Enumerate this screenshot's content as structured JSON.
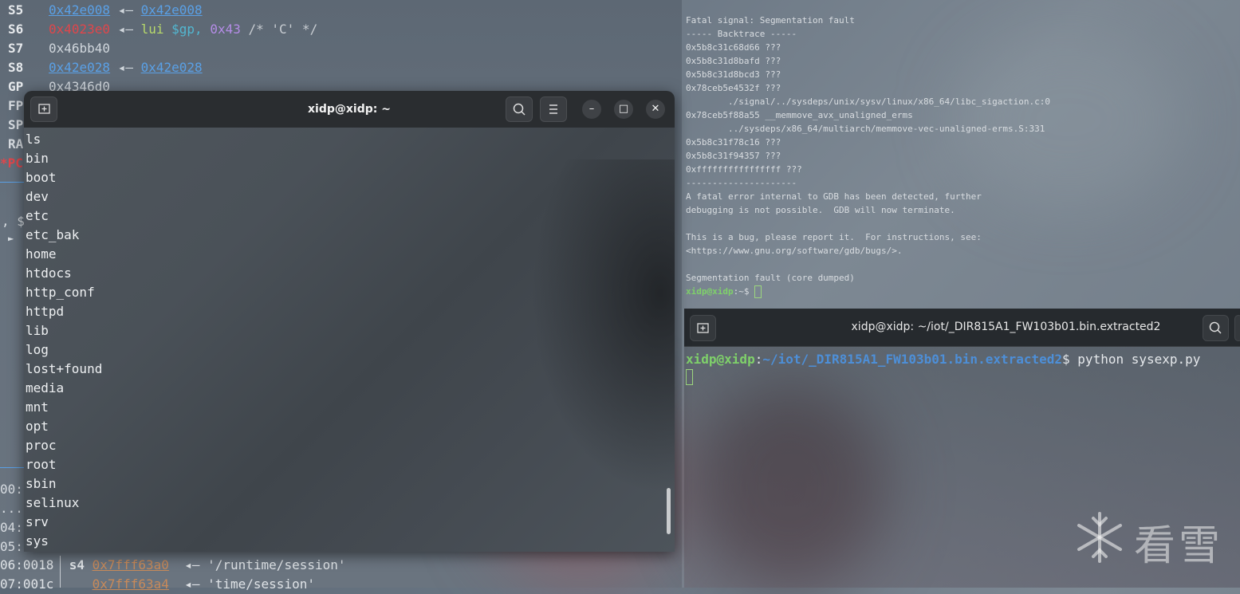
{
  "background_left": {
    "registers": [
      {
        "name": "S5",
        "value": "0x42e008",
        "arrow": "◂—",
        "target": "0x42e008"
      },
      {
        "name": "S6",
        "value": "0x4023e0",
        "arrow": "◂—",
        "instr": "lui",
        "reg": "$gp,",
        "imm": "0x43",
        "comment": "/* 'C' */"
      },
      {
        "name": "S7",
        "value": "0x46bb40"
      },
      {
        "name": "S8",
        "value": "0x42e028",
        "arrow": "◂—",
        "target": "0x42e028"
      },
      {
        "name": "GP",
        "value": "0x4346d0"
      }
    ],
    "edge_fragments": [
      "FP",
      "SP",
      "RA",
      "*PC",
      ", $",
      "►",
      "00:",
      "...",
      "04:",
      "05:"
    ],
    "stack": [
      {
        "prefix": "06:0018",
        "reg": "s4",
        "addr": "0x7fff63a0",
        "arrow": "◂—",
        "str": "'/runtime/session'"
      },
      {
        "prefix": "07:001c",
        "reg": "",
        "addr": "0x7fff63a4",
        "arrow": "◂—",
        "str": "'time/session'"
      }
    ]
  },
  "right_top_terminal": {
    "lines": [
      "Fatal signal: Segmentation fault",
      "----- Backtrace -----",
      "0x5b8c31c68d66 ???",
      "0x5b8c31d8bafd ???",
      "0x5b8c31d8bcd3 ???",
      "0x78ceb5e4532f ???",
      "        ./signal/../sysdeps/unix/sysv/linux/x86_64/libc_sigaction.c:0",
      "0x78ceb5f88a55 __memmove_avx_unaligned_erms",
      "        ../sysdeps/x86_64/multiarch/memmove-vec-unaligned-erms.S:331",
      "0x5b8c31f78c16 ???",
      "0x5b8c31f94357 ???",
      "0xffffffffffffffff ???",
      "---------------------",
      "A fatal error internal to GDB has been detected, further",
      "debugging is not possible.  GDB will now terminate.",
      "",
      "This is a bug, please report it.  For instructions, see:",
      "<https://www.gnu.org/software/gdb/bugs/>.",
      "",
      "Segmentation fault (core dumped)"
    ],
    "prompt_user": "xidp@xidp",
    "prompt_rest": ":~$ "
  },
  "right_bottom_terminal": {
    "title": "xidp@xidp: ~/iot/_DIR815A1_FW103b01.bin.extracted2",
    "prompt_user": "xidp@xidp",
    "prompt_sep": ":",
    "prompt_path": "~/iot/_DIR815A1_FW103b01.bin.extracted2",
    "prompt_dollar": "$ ",
    "command": "python sysexp.py"
  },
  "main_terminal": {
    "title": "xidp@xidp: ~",
    "lines": [
      "ls",
      "bin",
      "boot",
      "dev",
      "etc",
      "etc_bak",
      "home",
      "htdocs",
      "http_conf",
      "httpd",
      "lib",
      "log",
      "lost+found",
      "media",
      "mnt",
      "opt",
      "proc",
      "root",
      "sbin",
      "selinux",
      "srv",
      "sys"
    ],
    "buttons": {
      "minimize": "–",
      "maximize": "□",
      "close": "✕"
    }
  },
  "watermark": {
    "text": "看雪"
  },
  "colors": {
    "accent_green": "#7fd16a",
    "path_blue": "#4d8fd8",
    "addr_blue": "#5aa0e6",
    "addr_red": "#e0464b"
  }
}
